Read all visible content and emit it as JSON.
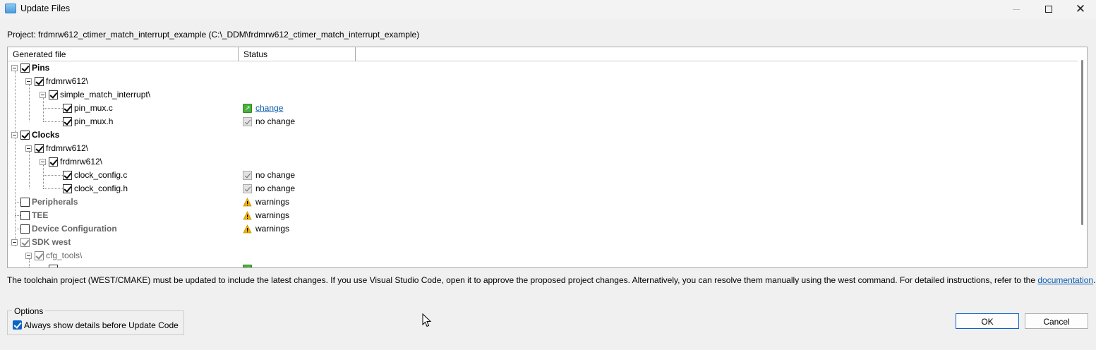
{
  "window": {
    "title": "Update Files",
    "minimize_glyph": "—",
    "close_glyph": "✕"
  },
  "project_line": "Project: frdmrw612_ctimer_match_interrupt_example (C:\\_DDM\\frdmrw612_ctimer_match_interrupt_example)",
  "table": {
    "col_generated": "Generated file",
    "col_status": "Status"
  },
  "tree": {
    "pins": "Pins",
    "pins_dir": "frdmrw612\\",
    "pins_sub": "simple_match_interrupt\\",
    "pin_mux_c": "pin_mux.c",
    "pin_mux_c_status": "change",
    "pin_mux_h": "pin_mux.h",
    "pin_mux_h_status": "no change",
    "clocks": "Clocks",
    "clocks_dir": "frdmrw612\\",
    "clocks_sub": "frdmrw612\\",
    "clock_c": "clock_config.c",
    "clock_c_status": "no change",
    "clock_h": "clock_config.h",
    "clock_h_status": "no change",
    "peripherals": "Peripherals",
    "peripherals_status": "warnings",
    "tee": "TEE",
    "tee_status": "warnings",
    "device_config": "Device Configuration",
    "device_config_status": "warnings",
    "sdk_west": "SDK west",
    "cfg_tools": "cfg_tools\\"
  },
  "info": {
    "text": "The toolchain project (WEST/CMAKE) must be updated to include the latest changes. If you use Visual Studio Code, open it to approve the proposed project changes. Alternatively, you can resolve them manually using the west command. For detailed instructions, refer to the",
    "link": "documentation",
    "end": "."
  },
  "options": {
    "legend": "Options",
    "always_show": "Always show details before Update Code"
  },
  "buttons": {
    "ok": "OK",
    "cancel": "Cancel"
  },
  "colors": {
    "accent": "#0a64c8",
    "link": "#0b5cad",
    "warning": "#f0b400",
    "change_icon": "#4caf3c"
  }
}
